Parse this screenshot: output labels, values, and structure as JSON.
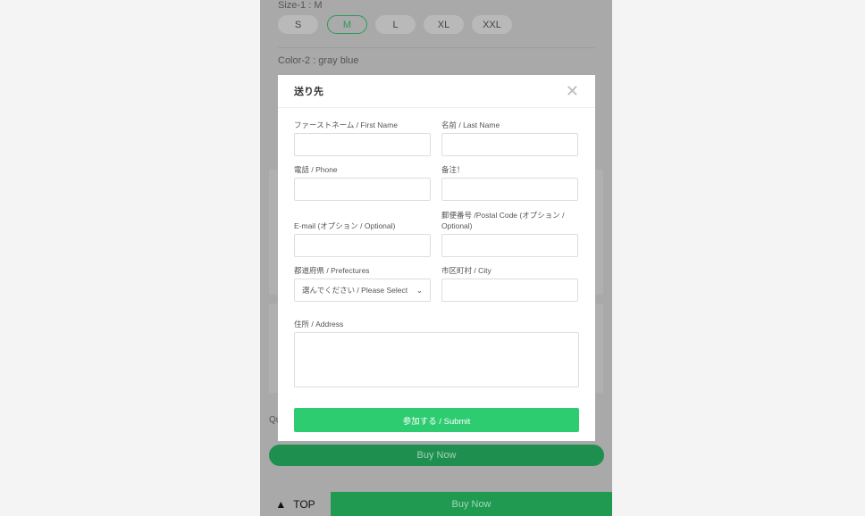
{
  "background": {
    "size_label": "Size-1 : M",
    "sizes": [
      "S",
      "M",
      "L",
      "XL",
      "XXL"
    ],
    "selected_size": "M",
    "color_label": "Color-2 : gray blue",
    "quantity_label": "Qu",
    "buy_now": "Buy Now"
  },
  "bottom_bar": {
    "top_label": "TOP",
    "buy_now": "Buy Now"
  },
  "modal": {
    "title": "送り先",
    "first_name_label": "ファーストネーム / First Name",
    "last_name_label": "名前 / Last Name",
    "phone_label": "電話 / Phone",
    "note_label": "备注！",
    "email_label": "E-mail (オプション / Optional)",
    "postal_label": "郵便番号 /Postal Code (オプション / Optional)",
    "prefecture_label": "都道府県 / Prefectures",
    "prefecture_value": "選んでください / Please Select",
    "city_label": "市区町村 / City",
    "address_label": "住所 / Address",
    "submit": "参加する / Submit"
  },
  "colors": {
    "accent": "#2ecc71",
    "buy": "#1f9a50"
  }
}
